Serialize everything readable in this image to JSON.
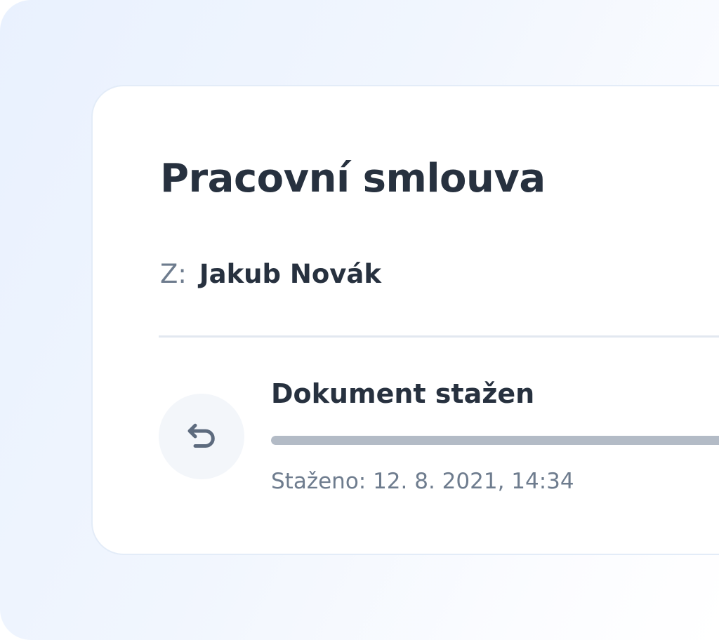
{
  "document": {
    "title": "Pracovní smlouva",
    "sender_label": "Z:",
    "sender_name": "Jakub Novák"
  },
  "status": {
    "title": "Dokument stažen",
    "progress": 1.0,
    "timestamp": "Staženo: 12. 8. 2021, 14:34"
  },
  "icons": {
    "reply": "undo-arrow-icon"
  },
  "colors": {
    "text_primary": "#27313f",
    "text_secondary": "#6e7c8e",
    "progress_fill": "#b3bbc6",
    "icon": "#5d6b7e"
  }
}
